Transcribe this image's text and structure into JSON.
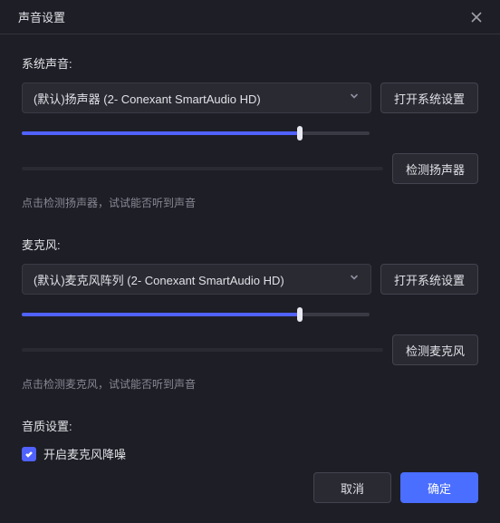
{
  "titlebar": {
    "title": "声音设置"
  },
  "speaker": {
    "label": "系统声音:",
    "device": "(默认)扬声器 (2- Conexant SmartAudio HD)",
    "open_settings_label": "打开系统设置",
    "volume_percent": 80,
    "test_label": "检测扬声器",
    "hint": "点击检测扬声器，试试能否听到声音"
  },
  "microphone": {
    "label": "麦克风:",
    "device": "(默认)麦克风阵列 (2- Conexant SmartAudio HD)",
    "open_settings_label": "打开系统设置",
    "volume_percent": 80,
    "test_label": "检测麦克风",
    "hint": "点击检测麦克风，试试能否听到声音"
  },
  "quality": {
    "label": "音质设置:",
    "noise_reduction_label": "开启麦克风降噪",
    "noise_reduction_checked": true
  },
  "footer": {
    "cancel_label": "取消",
    "confirm_label": "确定"
  },
  "colors": {
    "accent": "#4a6eff",
    "slider_fill": "#5062ff",
    "background": "#1e1e26"
  }
}
